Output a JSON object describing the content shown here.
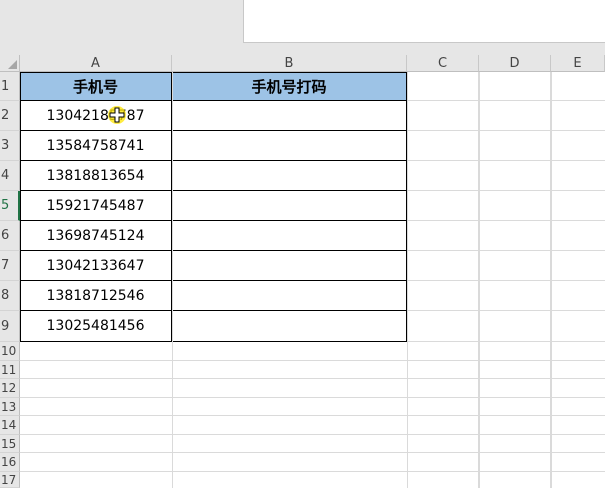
{
  "columns": [
    "A",
    "B",
    "C",
    "D",
    "E"
  ],
  "rows": [
    "1",
    "2",
    "3",
    "4",
    "5",
    "6",
    "7",
    "8",
    "9",
    "10",
    "11",
    "12",
    "13",
    "14",
    "15",
    "16",
    "17"
  ],
  "active_row": "5",
  "headers": {
    "a1": "手机号",
    "b1": "手机号打码"
  },
  "phones": [
    "13042185787",
    "13584758741",
    "13818813654",
    "15921745487",
    "13698745124",
    "13042133647",
    "13818712546",
    "13025481456"
  ],
  "colors": {
    "header_fill": "#9dc3e6",
    "active": "#217346",
    "cursor": "#ffe600"
  }
}
